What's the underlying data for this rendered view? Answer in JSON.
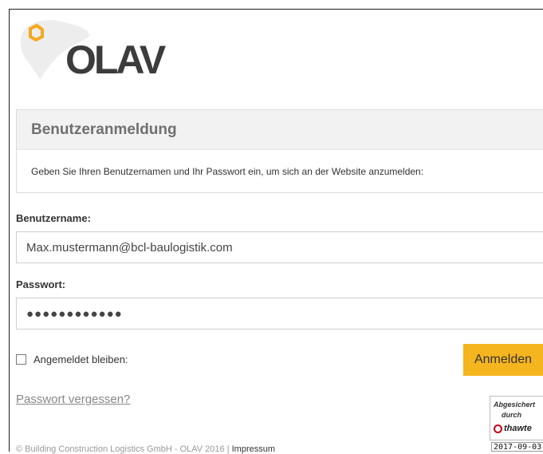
{
  "brand": {
    "logo_text": "OLAV",
    "accent_color": "#f5b51e"
  },
  "panel": {
    "title": "Benutzeranmeldung",
    "instruction": "Geben Sie Ihren Benutzernamen und Ihr Passwort ein, um sich an der Website anzumelden:"
  },
  "form": {
    "username_label": "Benutzername:",
    "username_value": "Max.mustermann@bcl-baulogistik.com",
    "password_label": "Passwort:",
    "password_mask": "●●●●●●●●●●●●",
    "remember_label": "Angemeldet bleiben:",
    "remember_checked": false,
    "login_button": "Anmelden",
    "forgot_link": "Passwort vergessen?"
  },
  "badge": {
    "line1": "Abgesichert",
    "line2": "durch",
    "brand": "thawte",
    "date": "2017-09-03"
  },
  "footer": {
    "copyright": "© Building Construction Logistics GmbH - OLAV 2016 | ",
    "impressum": "Impressum"
  }
}
